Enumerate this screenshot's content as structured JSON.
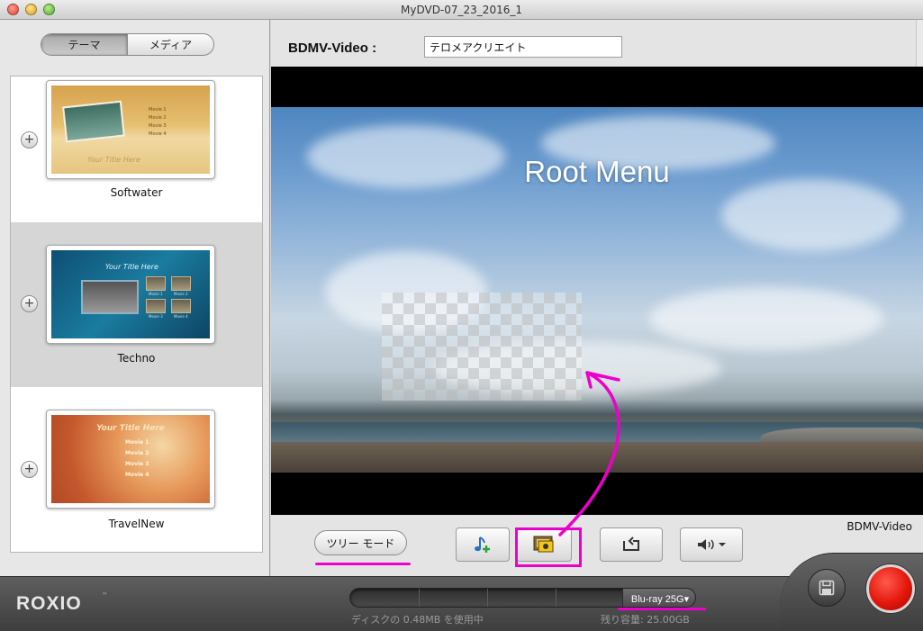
{
  "window": {
    "title": "MyDVD-07_23_2016_1"
  },
  "sidebar": {
    "tabs": [
      {
        "label": "テーマ",
        "selected": true
      },
      {
        "label": "メディア",
        "selected": false
      }
    ],
    "add_glyph": "+",
    "themes": [
      {
        "name": "Softwater",
        "selected": false,
        "thumb_text": {
          "menu": [
            "Movie 1",
            "Movie 2",
            "Movie 3",
            "Movie 4"
          ],
          "title": "Your Title Here"
        }
      },
      {
        "name": "Techno",
        "selected": true,
        "thumb_text": {
          "title": "Your Title Here",
          "menu": [
            "Movie 1",
            "Movie 2",
            "Movie 3",
            "Movie 4"
          ]
        }
      },
      {
        "name": "TravelNew",
        "selected": false,
        "thumb_text": {
          "title": "Your Title Here",
          "menu": [
            "Movie 1",
            "Movie 2",
            "Movie 3",
            "Movie 4"
          ]
        }
      }
    ]
  },
  "project": {
    "label": "BDMV-Video :",
    "name_value": "テロメアクリエイト"
  },
  "preview": {
    "menu_title": "Root Menu"
  },
  "toolbar": {
    "tree_mode_label": "ツリー モード",
    "format_label": "BDMV-Video",
    "add_music_icon": "music-note-plus-icon",
    "background_icon": "picture-frame-icon",
    "loop_icon": "loop-icon",
    "volume_icon": "speaker-icon"
  },
  "bottom": {
    "logo": "ROXIO",
    "logo_tm": "™",
    "disc_type": "Blu-ray 25G▾",
    "disc_used_text": "ディスクの 0.48MB を使用中",
    "disc_free_text": "残り容量: 25.00GB",
    "disc_used_fraction": 0.0
  },
  "colors": {
    "annotation": "#ee00cc",
    "burn_button": "#e3170c",
    "selected_theme_bg": "#d6d6d6"
  }
}
